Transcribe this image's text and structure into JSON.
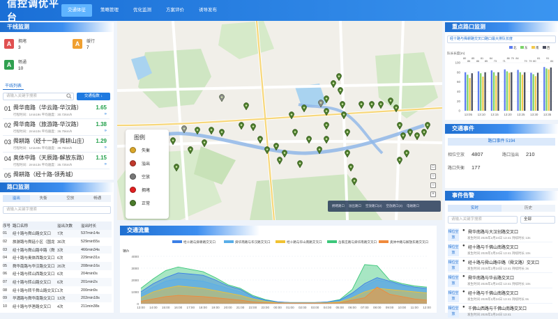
{
  "app": {
    "title": "信控调优平台"
  },
  "nav": [
    {
      "label": "交通体征",
      "active": true
    },
    {
      "label": "策略管理",
      "active": false
    },
    {
      "label": "优化监测",
      "active": false
    },
    {
      "label": "方案评价",
      "active": false
    },
    {
      "label": "诱导发布",
      "active": false
    }
  ],
  "trunk": {
    "title": "干线监测",
    "stats": [
      {
        "letter": "A",
        "label": "拥堵",
        "value": "3",
        "color": "#e05050"
      },
      {
        "letter": "A",
        "label": "缓行",
        "value": "7",
        "color": "#f0a030"
      },
      {
        "letter": "A",
        "label": "畅通",
        "value": "10",
        "color": "#30a050"
      }
    ],
    "list_tab": "干线列表",
    "search_placeholder": "请输入关键字搜索",
    "sort_button": "交通指数 ↓",
    "routes": [
      {
        "num": "01",
        "name": "舜华南路（华云路-华汉路）",
        "sub": "行程时间：1min19s    平均速度：30.72km/h",
        "value": "1.65"
      },
      {
        "num": "02",
        "name": "舜华南路（旅游路-华汉路）",
        "sub": "行程时间：2min10s    平均速度：36.75km/h",
        "value": "1.38"
      },
      {
        "num": "03",
        "name": "舜耕路（经十一路-舜耕山庄）",
        "sub": "行程时间：1min40s    平均速度：39.76km/h",
        "value": "1.29"
      },
      {
        "num": "04",
        "name": "奥体中路（天辰路-解放东路）",
        "sub": "行程时间：2min13s    平均速度：35.72km/h",
        "value": "1.15"
      },
      {
        "num": "05",
        "name": "舜耕路（经十路-领秀城）",
        "sub": "",
        "value": ""
      }
    ]
  },
  "intersection": {
    "title": "路口监测",
    "tabs": [
      {
        "label": "溢出",
        "on": true
      },
      {
        "label": "失衡",
        "on": false
      },
      {
        "label": "空放",
        "on": false
      },
      {
        "label": "畅通",
        "on": false
      }
    ],
    "search_placeholder": "请输入关键字搜索",
    "columns": [
      "序号",
      "路口名称",
      "溢出次数",
      "溢出时长"
    ],
    "rows": [
      [
        "01",
        "经十路与舜山路交叉口",
        "7次",
        "537min14s"
      ],
      [
        "02",
        "旅游路与舜延小区（国龙",
        "30次",
        "529min55s"
      ],
      [
        "03",
        "经十路与舜山路中路（舜",
        "3次",
        "466min34s"
      ],
      [
        "04",
        "经十路与奥体西路交叉口",
        "6次",
        "229min31s"
      ],
      [
        "05",
        "舜华南路与华汉路交叉口",
        "20次",
        "208min16s"
      ],
      [
        "06",
        "经十路与转山西路交叉口",
        "6次",
        "204min0s"
      ],
      [
        "07",
        "经十路与转山路交叉口",
        "6次",
        "201min2s"
      ],
      [
        "08",
        "经十路与转千舜山路交叉口",
        "1次",
        "200min9s"
      ],
      [
        "09",
        "华涌路与舜华南路交叉口",
        "13次",
        "202min18s"
      ],
      [
        "10",
        "经十路与华渔路交叉口",
        "4次",
        "211min38s"
      ]
    ]
  },
  "map_legend": {
    "title": "图例",
    "items": [
      {
        "label": "失衡",
        "color": "#d9a62a"
      },
      {
        "label": "溢出",
        "color": "#c0392b"
      },
      {
        "label": "空放",
        "color": "#777777"
      },
      {
        "label": "拥堵",
        "color": "#e02020"
      },
      {
        "label": "正常",
        "color": "#4a7a2a"
      }
    ]
  },
  "map_toolbar": [
    "拥堵路口",
    "溢出路口",
    "空放路口(2)",
    "空放路口(3)",
    "电磁路口"
  ],
  "map_controls": [
    "□",
    "○",
    "○",
    "+"
  ],
  "traffic_flow": {
    "title": "交通流量",
    "unit": "辆/h",
    "legend": [
      {
        "name": "经十路与舜耕路交叉口",
        "color": "#3b7fe6"
      },
      {
        "name": "舜华南路与华汉路交叉口",
        "color": "#5aaee8"
      },
      {
        "name": "经十路与华山南路交叉口",
        "color": "#f1c232"
      },
      {
        "name": "岳家庄路与舜华南路交叉口",
        "color": "#3cc77a"
      },
      {
        "name": "奥体中路与解放东路交叉口",
        "color": "#f08a3c"
      }
    ]
  },
  "chart_data": [
    {
      "type": "area",
      "title": "交通流量",
      "ylabel": "辆/h",
      "ylim": [
        0,
        4000
      ],
      "yticks": [
        0,
        1000,
        2000,
        3000,
        4000
      ],
      "x": [
        "13:00",
        "14:00",
        "15:00",
        "16:00",
        "17:00",
        "18:00",
        "19:00",
        "20:00",
        "21:00",
        "22:00",
        "23:00",
        "00:00",
        "01:00",
        "02:00",
        "03:00",
        "04:00",
        "05:00",
        "06:00",
        "07:00",
        "08:00",
        "09:00",
        "10:00",
        "11:00",
        "12:00"
      ],
      "series": [
        {
          "name": "经十路与舜耕路交叉口",
          "values": [
            1000,
            1700,
            2200,
            2600,
            2500,
            2400,
            2000,
            1500,
            1200,
            600,
            300,
            150,
            100,
            100,
            100,
            150,
            300,
            900,
            1700,
            2200,
            1900,
            1600,
            1400,
            1300
          ]
        },
        {
          "name": "舜华南路与华汉路交叉口",
          "values": [
            800,
            1400,
            1900,
            2100,
            2000,
            1900,
            1600,
            1300,
            1000,
            500,
            250,
            100,
            80,
            80,
            80,
            120,
            250,
            800,
            1500,
            2000,
            1800,
            1500,
            1300,
            1200
          ]
        },
        {
          "name": "经十路与华山南路交叉口",
          "values": [
            500,
            1000,
            1300,
            1500,
            1400,
            1300,
            1100,
            900,
            700,
            400,
            200,
            80,
            60,
            60,
            60,
            80,
            150,
            500,
            1000,
            1300,
            1200,
            1100,
            1000,
            900
          ]
        },
        {
          "name": "岳家庄路与舜华南路交叉口",
          "values": [
            1300,
            2100,
            2800,
            3100,
            2900,
            2700,
            2200,
            1600,
            1300,
            700,
            350,
            150,
            100,
            100,
            100,
            150,
            350,
            1200,
            3300,
            3200,
            2000,
            1700,
            1500,
            1400
          ]
        },
        {
          "name": "奥体中路与解放东路交叉口",
          "values": [
            200,
            400,
            600,
            700,
            650,
            600,
            500,
            400,
            300,
            150,
            80,
            50,
            40,
            40,
            40,
            50,
            80,
            300,
            500,
            1400,
            800,
            600,
            400,
            300
          ]
        }
      ]
    },
    {
      "type": "bar",
      "title": "经十路与舜耕路交叉口路口最大排队长度",
      "ylabel": "队长长度(m)",
      "ylim": [
        0,
        100
      ],
      "yticks": [
        0,
        20,
        40,
        60,
        80,
        100
      ],
      "categories": [
        "13:05",
        "13:10",
        "13:15",
        "13:20",
        "13:25",
        "13:30",
        "13:35"
      ],
      "series": [
        {
          "name": "北",
          "color": "#5d7df0",
          "values": [
            80,
            82,
            84,
            86,
            85,
            79,
            91
          ]
        },
        {
          "name": "东",
          "color": "#7bd36a",
          "values": [
            75,
            78,
            80,
            82,
            80,
            76,
            88
          ]
        },
        {
          "name": "南",
          "color": "#f2c94c",
          "values": [
            68,
            71,
            73,
            79,
            75,
            72,
            86
          ]
        },
        {
          "name": "西",
          "color": "#4a4f5e",
          "values": [
            78,
            80,
            80,
            80,
            80,
            79,
            90
          ]
        }
      ],
      "value_labels": [
        "80",
        "86",
        "85",
        "86",
        "81",
        "85",
        "84",
        "73",
        "79",
        "71",
        "86",
        "79",
        "84",
        "80",
        "81",
        "79",
        "91",
        "84"
      ]
    }
  ],
  "key_intersection": {
    "title": "重点路口监测",
    "select_value": "经十路与舜耕路交叉口路口最大排队长度",
    "legend": [
      {
        "name": "北",
        "color": "#5d7df0"
      },
      {
        "name": "东",
        "color": "#7bd36a"
      },
      {
        "name": "南",
        "color": "#f2c94c"
      },
      {
        "name": "西",
        "color": "#4a4f5e"
      }
    ]
  },
  "events": {
    "title": "交通事件",
    "road_label": "路口事件 5194",
    "items": [
      {
        "label": "相位空放",
        "value": "4807"
      },
      {
        "label": "路口溢出",
        "value": "210"
      },
      {
        "label": "路口失衡",
        "value": "177"
      }
    ]
  },
  "alarms": {
    "title": "事件告警",
    "tabs": [
      "实时",
      "历史"
    ],
    "search_placeholder": "请输入关键字搜索",
    "select_value": "全部",
    "items": [
      {
        "tag": "相位空放",
        "name": "舜华南路与大汉创路交叉口",
        "time": "发生时间 2025年2月24日 13:41  持续时长 13s"
      },
      {
        "tag": "相位空放",
        "name": "经十路与千佛山南路交叉口",
        "time": "发生时间 2025年2月24日 13:41  持续时长 10s"
      },
      {
        "tag": "相位空放",
        "name": "经十路与舜山路中路（舜文路）交叉口",
        "time": "发生时间 2025年2月24日 13:41  持续时长 3s"
      },
      {
        "tag": "相位空放",
        "name": "舜华南路与华云路交叉口",
        "time": "发生时间 2025年2月24日 13:41  持续时长 10s"
      },
      {
        "tag": "相位空放",
        "name": "经十路与千佛山南路交叉口",
        "time": "发生时间 2025年2月24日 13:41  持续时长 8s"
      },
      {
        "tag": "相位空放",
        "name": "千佛山西路与千佛山南路交叉口",
        "time": "发生时间 2025年2月24日 13:41"
      }
    ]
  }
}
